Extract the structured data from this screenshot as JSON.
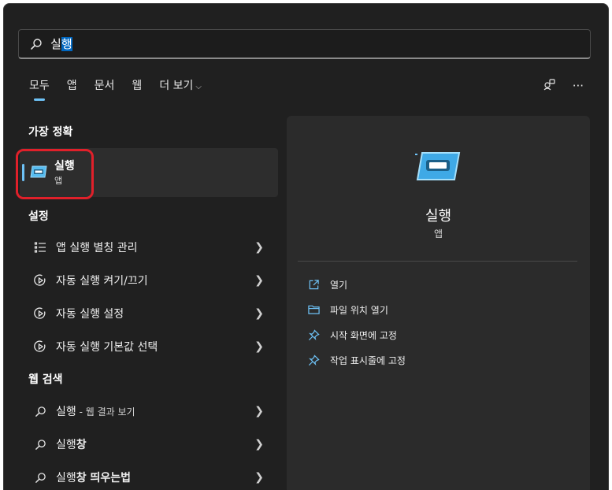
{
  "search": {
    "typed": "실",
    "selected": "행"
  },
  "tabs": [
    {
      "label": "모두",
      "active": true
    },
    {
      "label": "앱"
    },
    {
      "label": "문서"
    },
    {
      "label": "웹"
    },
    {
      "label": "더 보기",
      "chevron": "⌵"
    }
  ],
  "top_icons": {
    "account": "account-switch-icon",
    "more": "···"
  },
  "best_match": {
    "section": "가장 정확",
    "name": "실행",
    "type": "앱"
  },
  "settings": {
    "section": "설정",
    "items": [
      {
        "label": "앱 실행 별칭 관리",
        "icon": "list-icon"
      },
      {
        "label": "자동 실행 켜기/끄기",
        "icon": "startup-icon"
      },
      {
        "label": "자동 실행 설정",
        "icon": "startup-icon"
      },
      {
        "label": "자동 실행 기본값 선택",
        "icon": "startup-icon"
      }
    ]
  },
  "web": {
    "section": "웹 검색",
    "items": [
      {
        "label": "실행",
        "suffix": " - 웹 결과 보기"
      },
      {
        "label": "실행",
        "bold": "창"
      },
      {
        "label": "실행",
        "bold": "창 띄우는법"
      }
    ]
  },
  "preview": {
    "title": "실행",
    "type": "앱",
    "actions": [
      {
        "label": "열기",
        "icon": "open-icon"
      },
      {
        "label": "파일 위치 열기",
        "icon": "folder-icon"
      },
      {
        "label": "시작 화면에 고정",
        "icon": "pin-icon"
      },
      {
        "label": "작업 표시줄에 고정",
        "icon": "pin-icon"
      }
    ]
  },
  "colors": {
    "accent": "#6ec2f6",
    "panel": "#202020",
    "highlight": "#e0202a"
  }
}
